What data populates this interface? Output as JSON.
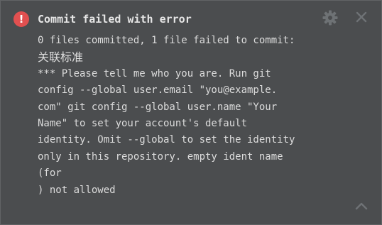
{
  "notification": {
    "title": "Commit failed with error",
    "severity_icon": "error-icon",
    "accent_color": "#e25050",
    "message_lines": [
      "0 files committed, 1 file failed to commit:",
      "关联标准",
      "*** Please tell me who you are. Run git",
      "config --global user.email \"you@example.",
      "com\" git config --global user.name \"Your",
      "Name\" to set your account's default",
      "identity. Omit --global to set the identity",
      "only in this repository. empty ident name",
      "(for",
      ") not allowed"
    ],
    "actions": {
      "settings_icon": "gear-icon",
      "close_icon": "close-icon",
      "collapse_icon": "chevron-up-icon"
    }
  }
}
